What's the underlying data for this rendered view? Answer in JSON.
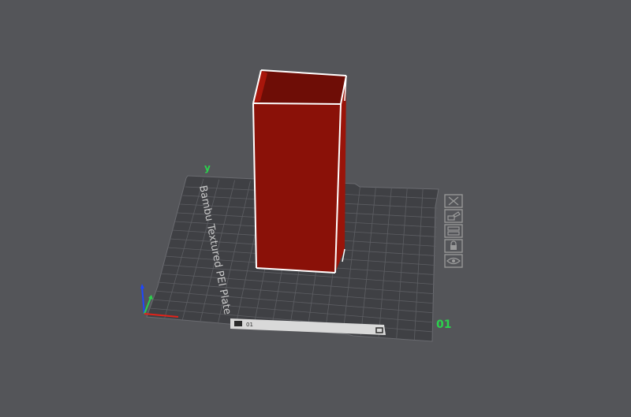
{
  "scene": {
    "background_color": "#545559",
    "plate": {
      "label": "Bambu Textured PEI Plate",
      "number": "01",
      "secondary_label": "y",
      "bottom_tab_text": "01",
      "color": "#3f4044",
      "grid_color": "#5d5e63",
      "label_color": "#c9c9c9"
    },
    "model": {
      "color": "#8a1108",
      "edge_color": "#ffffff",
      "selected": true
    },
    "axes": {
      "x_color": "#e2231a",
      "y_color": "#2bd14d",
      "z_color": "#1d47ff"
    },
    "plate_buttons": [
      {
        "name": "delete-plate-icon",
        "icon": "x"
      },
      {
        "name": "arrange-plate-icon",
        "icon": "arrange"
      },
      {
        "name": "orient-plate-icon",
        "icon": "orient"
      },
      {
        "name": "lock-plate-icon",
        "icon": "lock"
      },
      {
        "name": "settings-plate-icon",
        "icon": "eye"
      }
    ]
  }
}
